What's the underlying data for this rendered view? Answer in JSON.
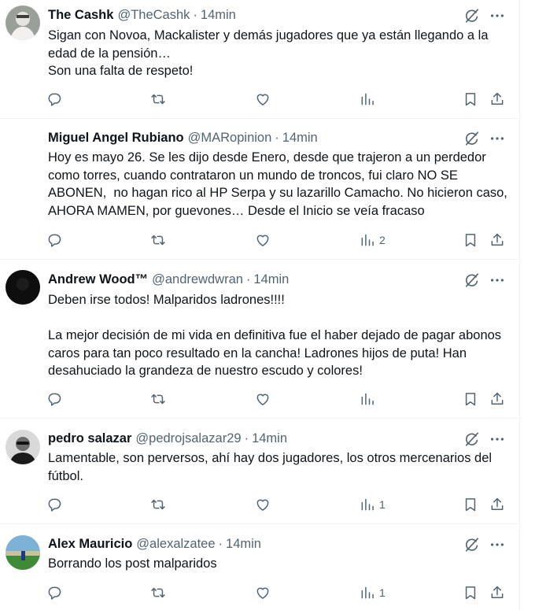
{
  "tweets": [
    {
      "name": "The Cashk",
      "handle": "@TheCashk",
      "separator": "·",
      "time": "14min",
      "lines": [
        "Sigan con Novoa, Mackalister y demás jugadores que ya están llegando a la edad de la pensión…",
        "Son una falta de respeto!"
      ],
      "views": ""
    },
    {
      "name": "Miguel Angel Rubiano",
      "handle": "@MARopinion",
      "separator": "·",
      "time": "14min",
      "lines": [
        "Hoy es mayo 26. Se les dijo desde Enero, desde que trajeron a un perdedor como torres, cuando contrataron un mundo de troncos, fui claro NO SE ABONEN,  no hagan rico al HP Serpa y su lazarillo Camacho. No hicieron caso, AHORA MAMEN, por guevones… Desde el Inicio se veía fracaso"
      ],
      "views": "2"
    },
    {
      "name": "Andrew Wood™",
      "handle": "@andrewdwran",
      "separator": "·",
      "time": "14min",
      "lines": [
        "Deben irse todos! Malparidos ladrones!!!!",
        "La mejor decisión de mi vida en definitiva fue el haber dejado de pagar abonos caros para tan poco resultado en la cancha! Ladrones hijos de puta! Han desahuciado la grandeza de nuestro escudo y colores!"
      ],
      "views": ""
    },
    {
      "name": "pedro salazar",
      "handle": "@pedrojsalazar29",
      "separator": "·",
      "time": "14min",
      "lines": [
        "Lamentable, son perversos, ahí hay dos jugadores, los otros mercenarios del fútbol."
      ],
      "views": "1"
    },
    {
      "name": "Alex Mauricio",
      "handle": "@alexalzatee",
      "separator": "·",
      "time": "14min",
      "lines": [
        "Borrando los post malparidos"
      ],
      "views": "1"
    }
  ],
  "icons": {
    "reply": "reply-icon",
    "retweet": "retweet-icon",
    "like": "like-icon",
    "views": "views-icon",
    "bookmark": "bookmark-icon",
    "share": "share-icon",
    "grok": "grok-icon",
    "more": "more-icon"
  },
  "colors": {
    "text": "#0f1419",
    "secondary": "#536471",
    "divider": "#eff3f4"
  }
}
